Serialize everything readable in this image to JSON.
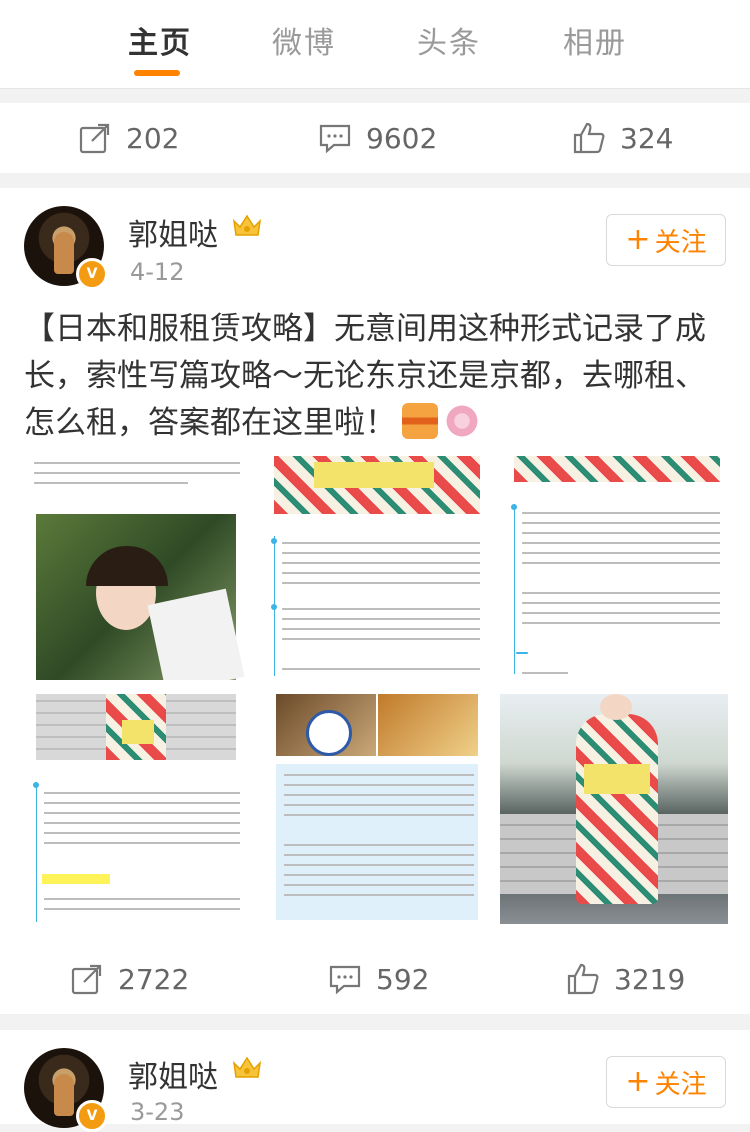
{
  "tabs": [
    {
      "label": "主页"
    },
    {
      "label": "微博"
    },
    {
      "label": "头条"
    },
    {
      "label": "相册"
    }
  ],
  "prev_post_actions": {
    "repost": "202",
    "comment": "9602",
    "like": "324"
  },
  "post1": {
    "author": "郭姐哒",
    "time": "4-12",
    "follow_label": "关注",
    "text": "【日本和服租赁攻略】无意间用这种形式记录了成长，索性写篇攻略～无论东京还是京都，去哪租、怎么租，答案都在这里啦！",
    "actions": {
      "repost": "2722",
      "comment": "592",
      "like": "3219"
    }
  },
  "post2": {
    "author": "郭姐哒",
    "time": "3-23",
    "follow_label": "关注"
  },
  "colors": {
    "accent": "#ff8200",
    "verified": "#f39c12"
  }
}
